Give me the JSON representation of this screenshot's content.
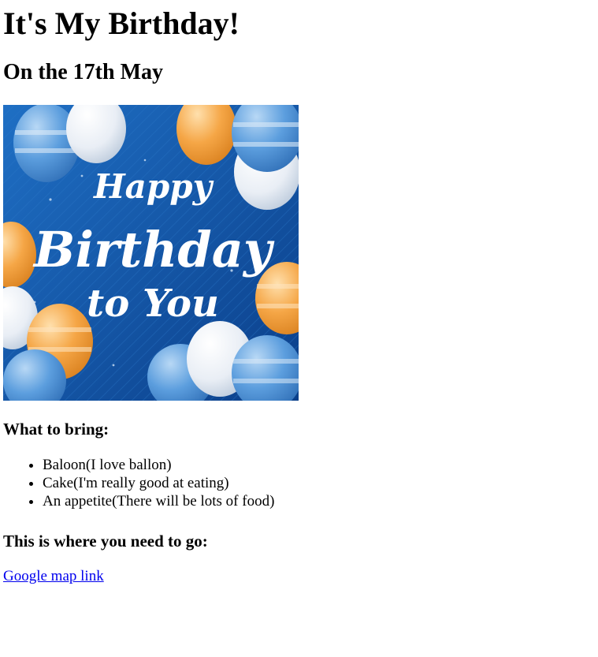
{
  "page": {
    "title": "It's My Birthday!",
    "date_heading": "On the 17th May",
    "image": {
      "alt": "Happy Birthday to you balloons",
      "text_lines": [
        "Happy",
        "Birthday",
        "to You"
      ],
      "colors": {
        "background": "#1356a8",
        "balloon_blue": "#4a8fd6",
        "balloon_orange": "#f2a447",
        "balloon_white": "#eef2f7"
      }
    },
    "bring_heading": "What to bring:",
    "bring_items": [
      "Baloon(I love ballon)",
      "Cake(I'm really good at eating)",
      "An appetite(There will be lots of food)"
    ],
    "go_heading": "This is where you need to go:",
    "map_link_label": "Google map link",
    "link_color": "#0000ee"
  }
}
